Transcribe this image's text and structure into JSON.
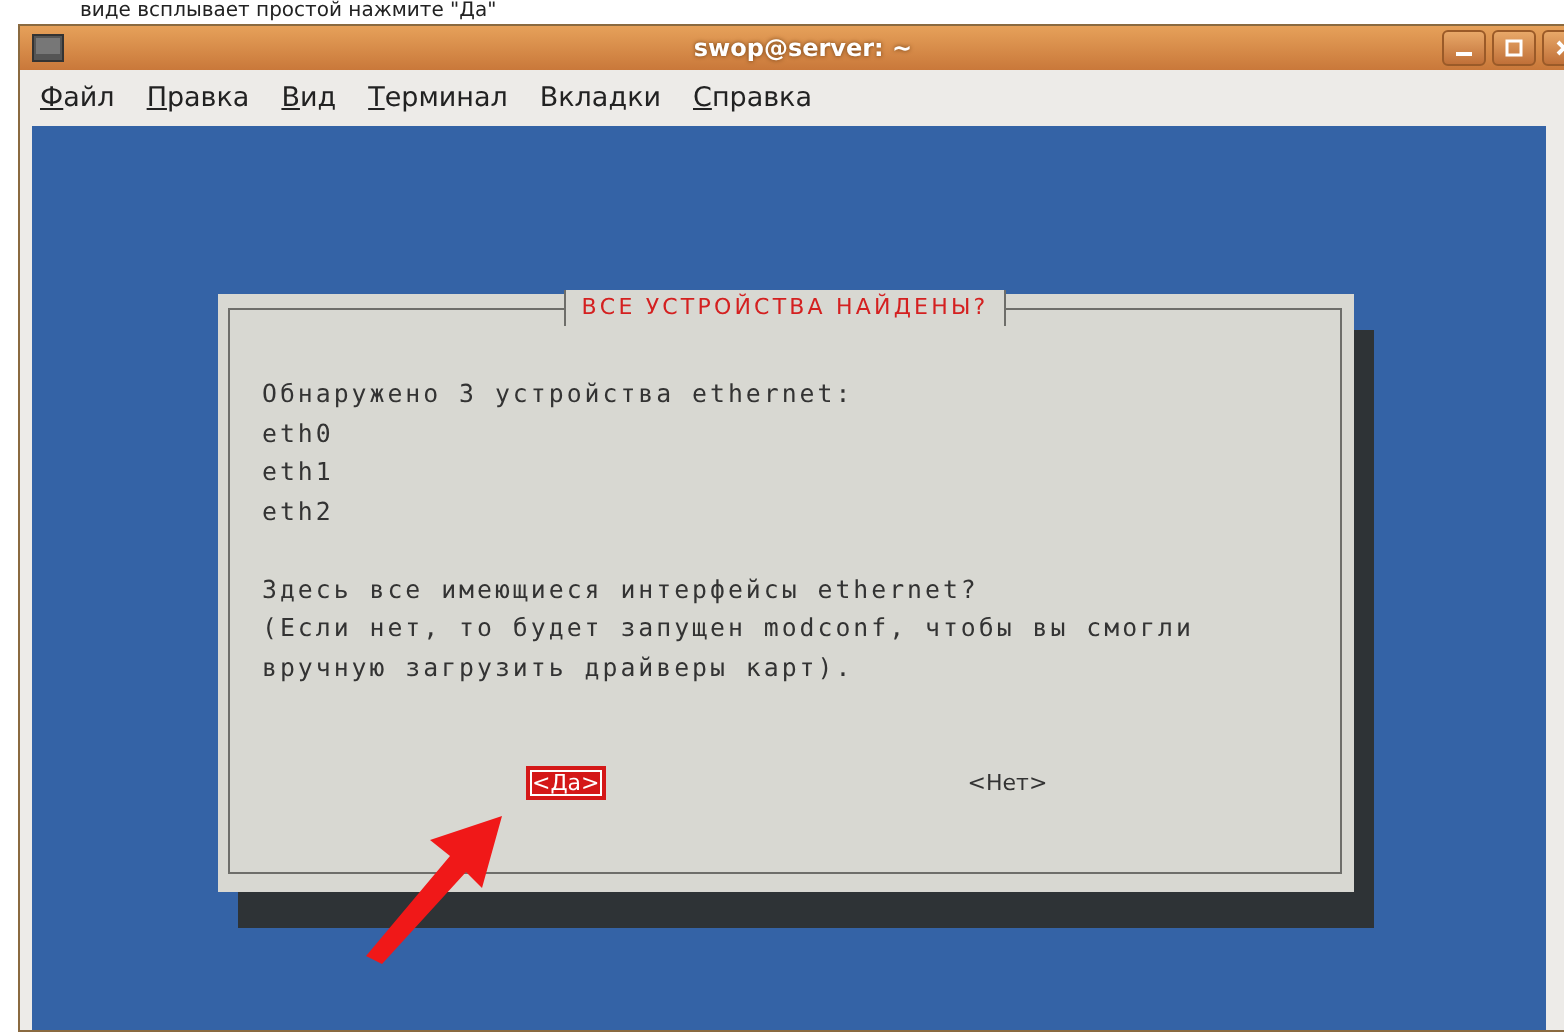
{
  "caption": "виде всплывает простой нажмите \"Да\"",
  "window": {
    "title": "swop@server: ~"
  },
  "menu": [
    {
      "label": "Файл"
    },
    {
      "label": "Правка"
    },
    {
      "label": "Вид"
    },
    {
      "label": "Терминал"
    },
    {
      "label": "Вкладки"
    },
    {
      "label": "Справка"
    }
  ],
  "dialog": {
    "title": "ВСЕ УСТРОЙСТВА НАЙДЕНЫ?",
    "paragraphs": [
      [
        "Обнаружено 3 устройства ethernet:",
        "eth0",
        "eth1",
        "eth2"
      ],
      [
        "Здесь все имеющиеся интерфейсы ethernet?",
        "(Если нет, то будет запущен modconf, чтобы вы смогли",
        "вручную загрузить драйверы карт)."
      ]
    ],
    "buttons": [
      {
        "label": "<Да>",
        "selected": true
      },
      {
        "label": "<Нет>",
        "selected": false
      }
    ]
  }
}
